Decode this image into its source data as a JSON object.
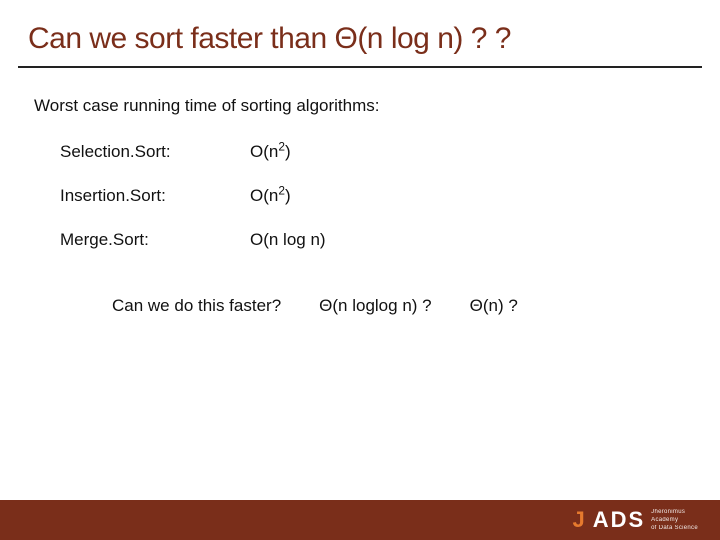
{
  "title": "Can we sort faster than Θ(n log n) ? ?",
  "intro": "Worst case running time of sorting algorithms:",
  "algos": [
    {
      "name": "Selection.Sort:",
      "comp_prefix": "O(n",
      "comp_sup": "2",
      "comp_suffix": ")"
    },
    {
      "name": "Insertion.Sort:",
      "comp_prefix": "O(n",
      "comp_sup": "2",
      "comp_suffix": ")"
    },
    {
      "name": "Merge.Sort:",
      "comp_prefix": "O(n log n)",
      "comp_sup": "",
      "comp_suffix": ""
    }
  ],
  "question_lead": "Can we do this faster?",
  "question_opts": [
    "Θ(n loglog n) ?",
    "Θ(n) ?"
  ],
  "logo": {
    "j": "J",
    "rest": "ADS",
    "sub1": "Jheronimus",
    "sub2": "Academy",
    "sub3": "of Data Science"
  }
}
